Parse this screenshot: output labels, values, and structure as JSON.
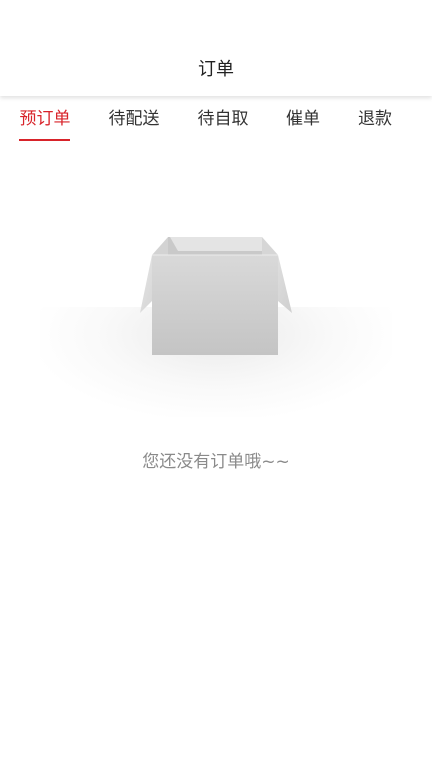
{
  "header": {
    "title": "订单"
  },
  "tabs": [
    {
      "label": "预订单",
      "active": true
    },
    {
      "label": "待配送",
      "active": false
    },
    {
      "label": "待自取",
      "active": false
    },
    {
      "label": "催单",
      "active": false
    },
    {
      "label": "退款",
      "active": false
    }
  ],
  "empty_state": {
    "icon": "empty-box-icon",
    "message": "您还没有订单哦~~"
  },
  "colors": {
    "accent": "#d8232a",
    "tab_text": "#333333",
    "empty_text": "#8a8a8a"
  }
}
